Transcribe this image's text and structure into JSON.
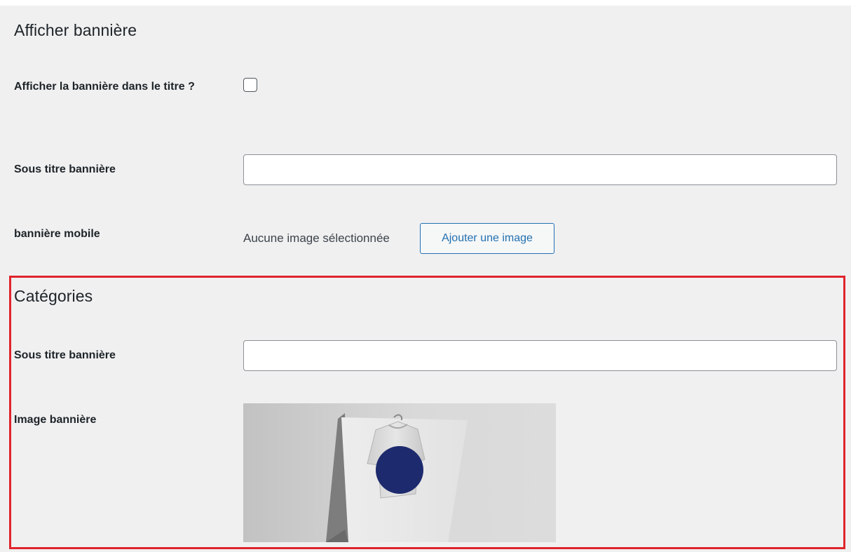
{
  "display_banner": {
    "title": "Afficher bannière",
    "show_in_title": {
      "label": "Afficher la bannière dans le titre ?",
      "checked": false
    },
    "subtitle": {
      "label": "Sous titre bannière",
      "value": ""
    },
    "mobile_banner": {
      "label": "bannière mobile",
      "status": "Aucune image sélectionnée",
      "button_label": "Ajouter une image"
    }
  },
  "categories": {
    "title": "Catégories",
    "subtitle": {
      "label": "Sous titre bannière",
      "value": ""
    },
    "image": {
      "label": "Image bannière",
      "subject": "t-shirt with navy circle on hanger"
    }
  },
  "colors": {
    "panel_bg": "#f0f0f1",
    "highlight_border": "#e0242c",
    "button_accent": "#2271b1",
    "shirt_circle": "#1e2a6e"
  },
  "icons": {
    "checkbox": "checkbox-empty-icon"
  }
}
